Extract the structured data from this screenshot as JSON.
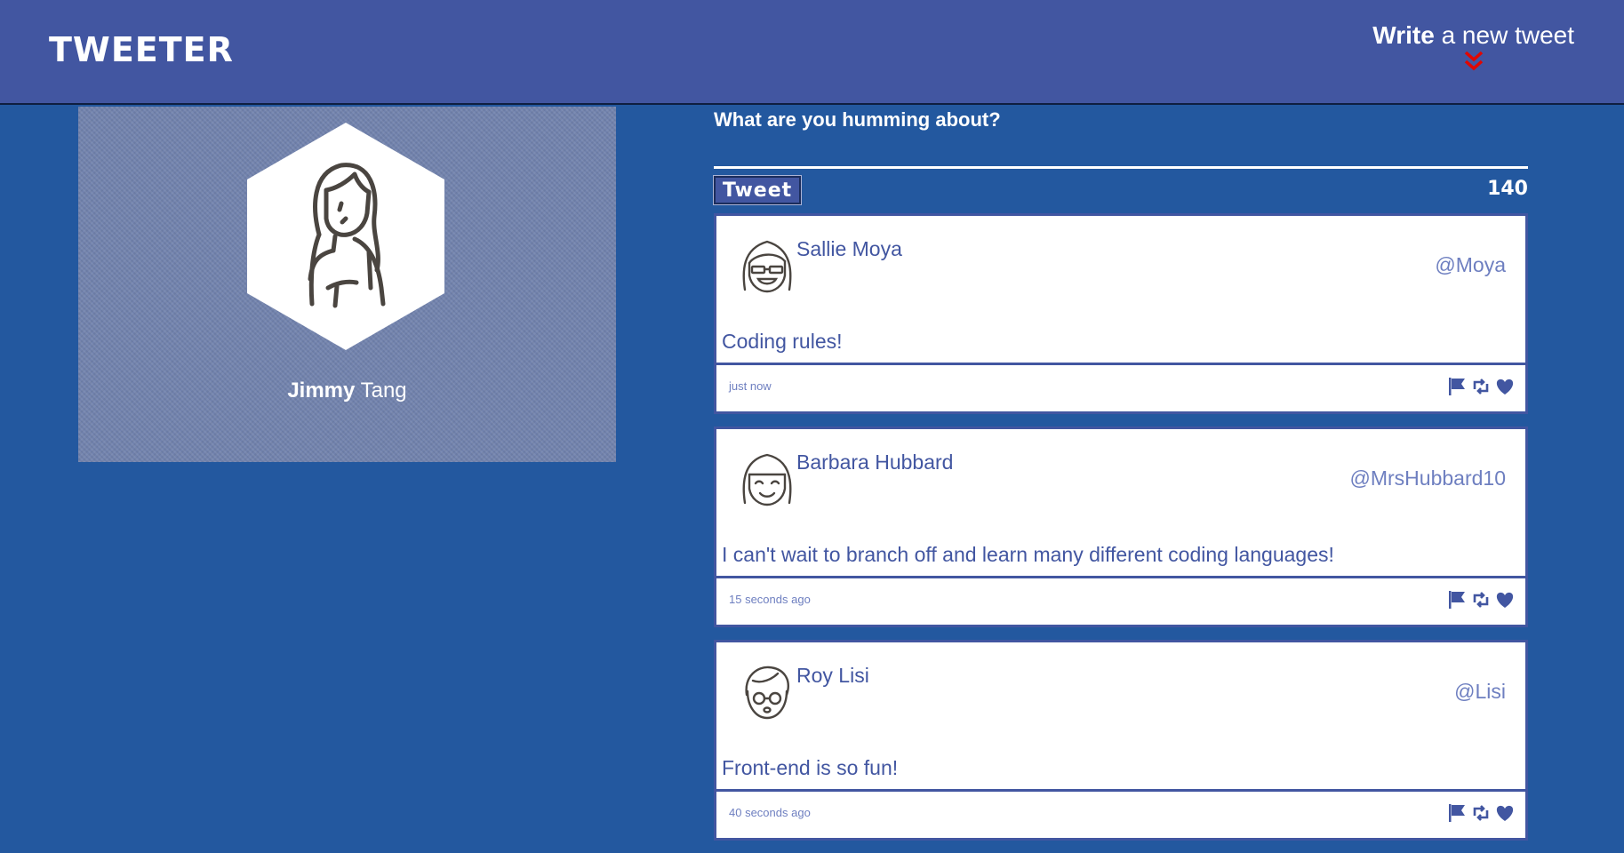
{
  "nav": {
    "brand": "Tweeter",
    "compose_bold": "Write",
    "compose_rest": " a new tweet",
    "arrow_icon": "double-chevron-down-icon",
    "arrow_color": "#e10600"
  },
  "profile": {
    "avatar_icon": "woman-avatar-icon",
    "first_name": "Jimmy",
    "last_name": " Tang"
  },
  "composer": {
    "prompt": "What are you humming about?",
    "textarea_value": "",
    "button_label": "Tweet",
    "counter": "140"
  },
  "tweets": [
    {
      "name": "Sallie Moya",
      "handle": "@Moya",
      "avatar_icon": "girl-sunglasses-avatar-icon",
      "content": "Coding rules!",
      "timestamp": "just now"
    },
    {
      "name": "Barbara Hubbard",
      "handle": "@MrsHubbard10",
      "avatar_icon": "girl-smiling-avatar-icon",
      "content": "I can't wait to branch off and learn many different coding languages!",
      "timestamp": "15 seconds ago"
    },
    {
      "name": "Roy Lisi",
      "handle": "@Lisi",
      "avatar_icon": "boy-glasses-avatar-icon",
      "content": "Front-end is so fun!",
      "timestamp": "40 seconds ago"
    }
  ],
  "action_icons": [
    "flag-icon",
    "retweet-icon",
    "heart-icon"
  ],
  "colors": {
    "background": "#23589f",
    "nav": "#4256a1",
    "accent": "#4256a1"
  }
}
